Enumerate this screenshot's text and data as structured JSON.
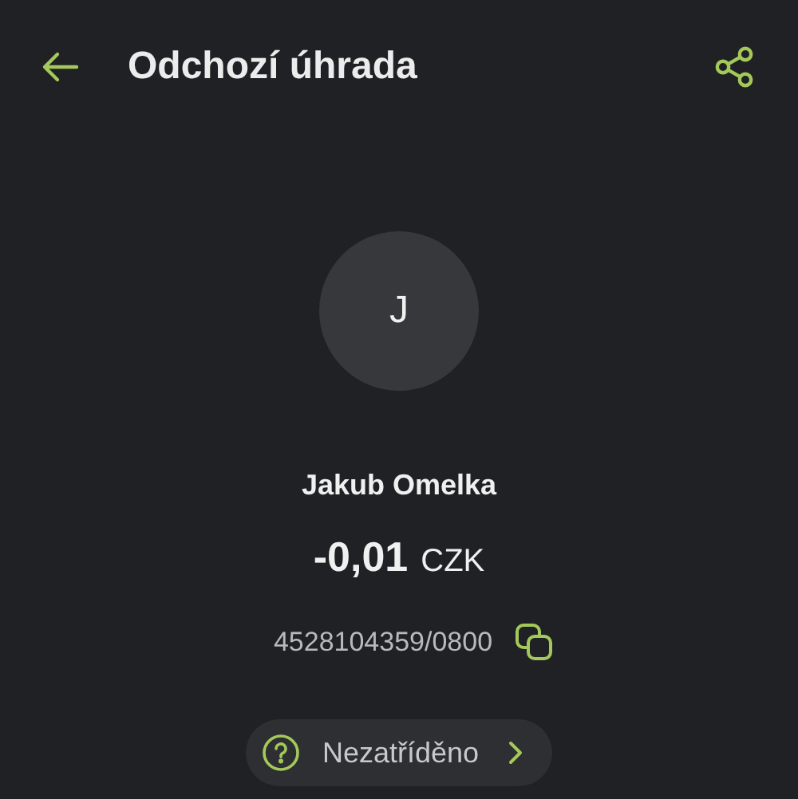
{
  "header": {
    "title": "Odchozí úhrada"
  },
  "counterparty": {
    "initial": "J",
    "name": "Jakub Omelka"
  },
  "amount": {
    "value": "-0,01",
    "currency": "CZK"
  },
  "account": {
    "number": "4528104359/0800"
  },
  "category": {
    "label": "Nezatříděno"
  }
}
